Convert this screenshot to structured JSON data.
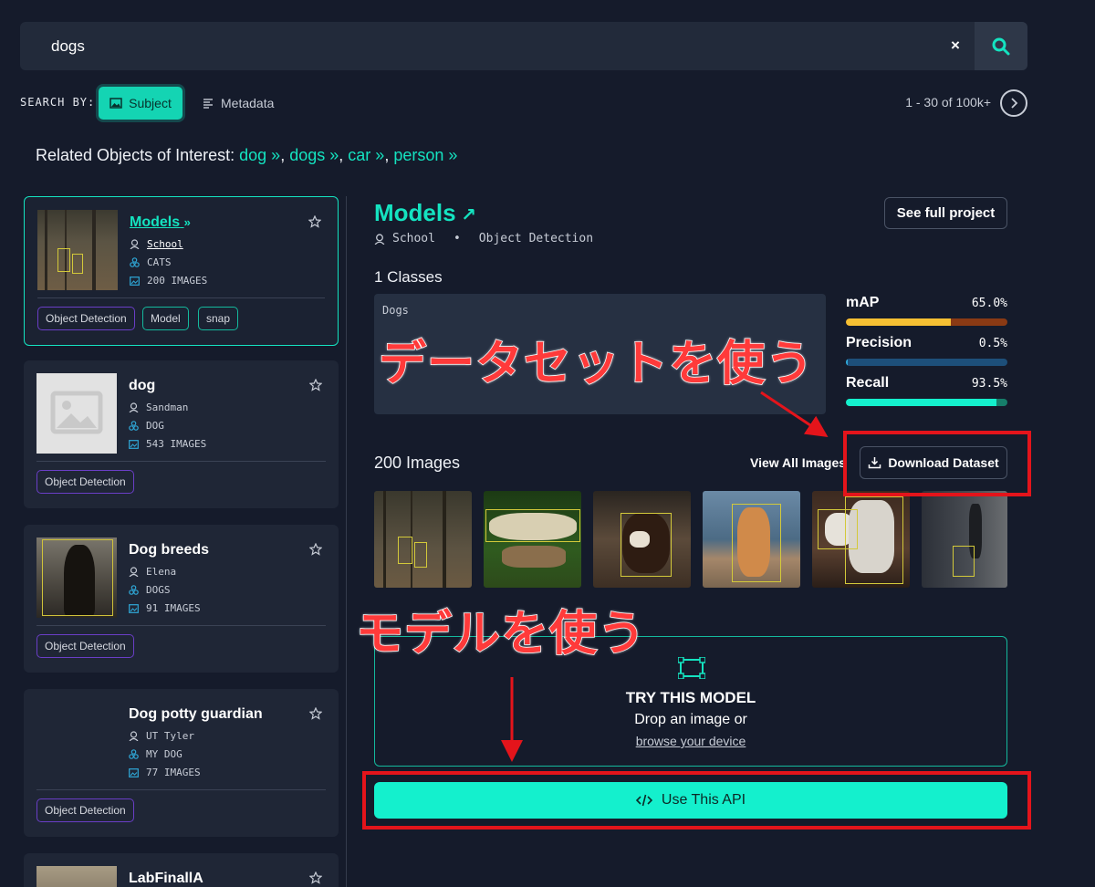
{
  "search": {
    "value": "dogs",
    "clear_label": "×"
  },
  "search_by": {
    "label": "SEARCH BY:",
    "subject_label": "Subject",
    "metadata_label": "Metadata"
  },
  "pager": {
    "text": "1 - 30 of 100k+"
  },
  "related": {
    "prefix": "Related Objects of Interest:",
    "items": [
      "dog",
      "dogs",
      "car",
      "person"
    ]
  },
  "results": [
    {
      "title": "Models",
      "owner": "School",
      "class_name": "CATS",
      "images": "200 IMAGES",
      "tags": [
        "Object Detection",
        "Model",
        "snap"
      ]
    },
    {
      "title": "dog",
      "owner": "Sandman",
      "class_name": "DOG",
      "images": "543 IMAGES",
      "tags": [
        "Object Detection"
      ]
    },
    {
      "title": "Dog breeds",
      "owner": "Elena",
      "class_name": "DOGS",
      "images": "91 IMAGES",
      "tags": [
        "Object Detection"
      ]
    },
    {
      "title": "Dog potty guardian",
      "owner": "UT Tyler",
      "class_name": "MY DOG",
      "images": "77 IMAGES",
      "tags": [
        "Object Detection"
      ]
    },
    {
      "title": "LabFinallA"
    }
  ],
  "project": {
    "title": "Models",
    "owner": "School",
    "type": "Object Detection",
    "see_full_label": "See full project",
    "classes_heading": "1 Classes",
    "classes": [
      "Dogs"
    ],
    "metrics": [
      {
        "label": "mAP",
        "value": "65.0%",
        "fraction": 0.65,
        "fill": "#f5c033",
        "track": "#8a3a14"
      },
      {
        "label": "Precision",
        "value": "0.5%",
        "fraction": 0.005,
        "fill": "#2fa8d8",
        "track": "#1d4f7a"
      },
      {
        "label": "Recall",
        "value": "93.5%",
        "fraction": 0.935,
        "fill": "#14f0cd",
        "track": "#167e6a"
      }
    ],
    "images_heading": "200 Images",
    "view_all_label": "View All Images",
    "download_label": "Download Dataset",
    "try": {
      "title": "TRY THIS MODEL",
      "subtitle": "Drop an image or",
      "link": "browse your device"
    },
    "api_label": "Use This API"
  },
  "annotations": {
    "dataset_label": "データセットを使う",
    "model_label": "モデルを使う",
    "color": "#e4141b"
  }
}
